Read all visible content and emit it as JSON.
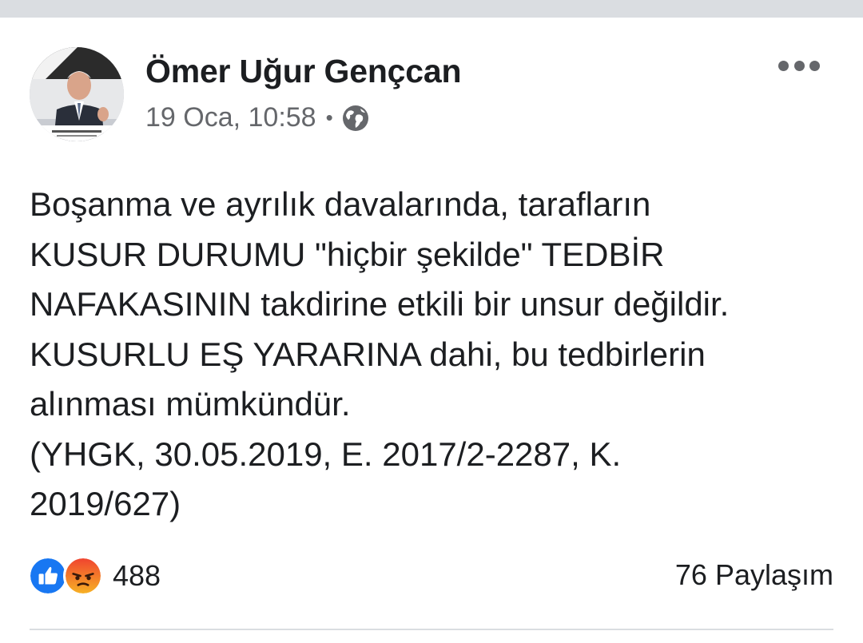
{
  "post": {
    "author": "Ömer Uğur Gençcan",
    "timestamp": "19 Oca, 10:58",
    "separator": "•",
    "privacy_icon": "globe-icon",
    "menu_icon": "more-horizontal-icon",
    "text_lines": [
      "Boşanma ve ayrılık davalarında, tarafların",
      "KUSUR DURUMU \"hiçbir şekilde\" TEDBİR",
      "NAFAKASININ takdirine etkili bir unsur değildir.",
      "KUSURLU EŞ YARARINA dahi, bu tedbirlerin",
      "alınması mümkündür.",
      "(YHGK, 30.05.2019, E. 2017/2-2287, K.",
      "2019/627)"
    ],
    "reactions": {
      "icons": [
        "like-icon",
        "angry-icon"
      ],
      "count": "488"
    },
    "shares": "76 Paylaşım"
  },
  "colors": {
    "like_blue": "#1877f2",
    "angry_orange": "#f5533d",
    "secondary_text": "#65676b",
    "primary_text": "#1c1e21"
  }
}
